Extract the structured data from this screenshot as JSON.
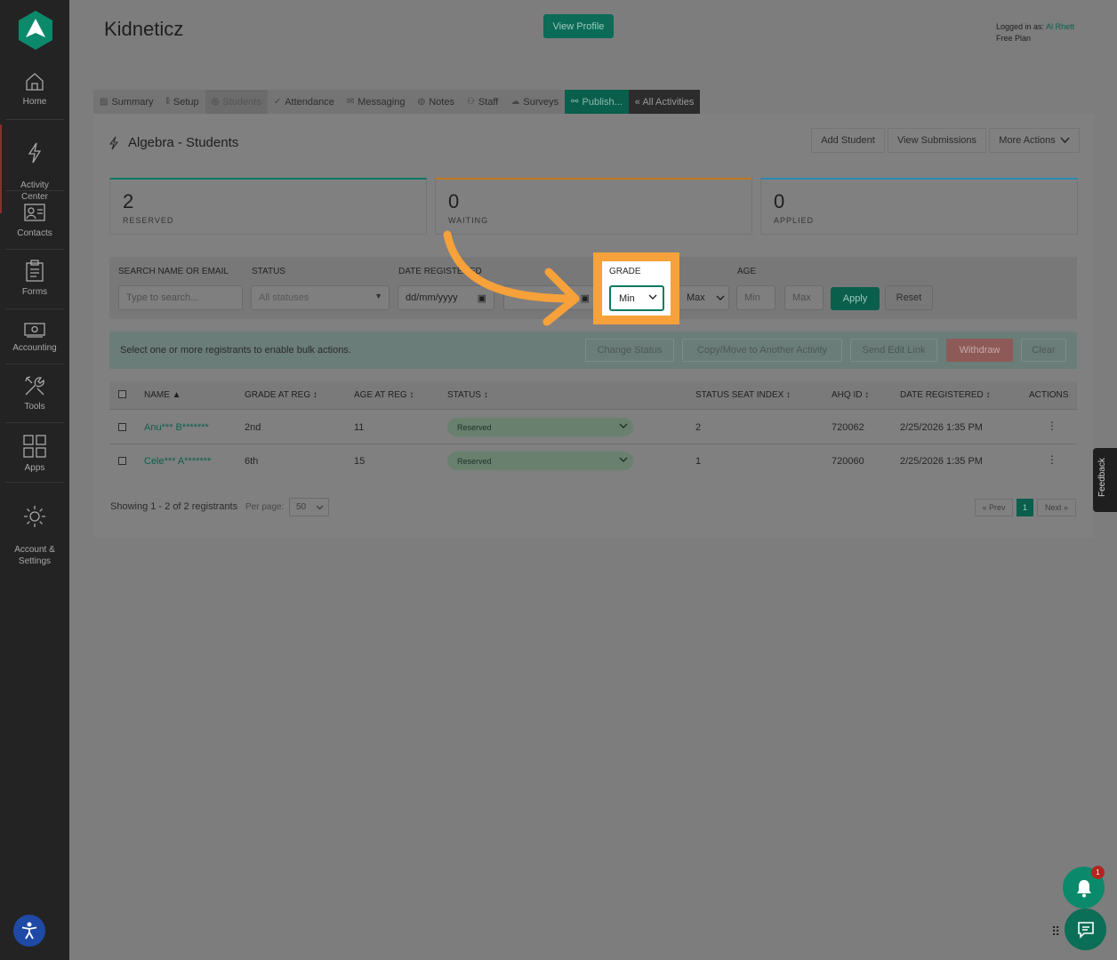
{
  "sidebar": {
    "items": [
      {
        "label": "Home",
        "icon": "home-icon"
      },
      {
        "label": "Activity\nCenter",
        "icon": "lightning-icon"
      },
      {
        "label": "Contacts",
        "icon": "contacts-icon"
      },
      {
        "label": "Forms",
        "icon": "clipboard-icon"
      },
      {
        "label": "Accounting",
        "icon": "money-icon"
      },
      {
        "label": "Tools",
        "icon": "tools-icon"
      },
      {
        "label": "Apps",
        "icon": "apps-grid-icon"
      },
      {
        "label": "Account &\nSettings",
        "icon": "gear-icon"
      }
    ]
  },
  "header": {
    "title": "Kidneticz",
    "view_profile": "View Profile",
    "logged_in_label": "Logged in as: ",
    "user": "Al Rhett",
    "plan": "Free Plan"
  },
  "tabs": [
    {
      "label": "Summary",
      "icon": "summary-icon"
    },
    {
      "label": "Setup",
      "icon": "setup-icon"
    },
    {
      "label": "Students",
      "icon": "students-icon"
    },
    {
      "label": "Attendance",
      "icon": "check-icon"
    },
    {
      "label": "Messaging",
      "icon": "mail-icon"
    },
    {
      "label": "Notes",
      "icon": "notes-icon"
    },
    {
      "label": "Staff",
      "icon": "staff-icon"
    },
    {
      "label": "Surveys",
      "icon": "cloud-icon"
    },
    {
      "label": "Publish...",
      "icon": "link-icon"
    },
    {
      "label": "« All Activities",
      "icon": ""
    }
  ],
  "section": {
    "title": "Algebra - Students",
    "add_student": "Add Student",
    "view_submissions": "View Submissions",
    "more_actions": "More Actions"
  },
  "stats": [
    {
      "value": "2",
      "label": "RESERVED",
      "color": "#0b7a63"
    },
    {
      "value": "0",
      "label": "WAITING",
      "color": "#c07a1e"
    },
    {
      "value": "0",
      "label": "APPLIED",
      "color": "#2a8ab3"
    }
  ],
  "filters": {
    "search_label": "SEARCH NAME OR EMAIL",
    "search_placeholder": "Type to search...",
    "status_label": "STATUS",
    "status_value": "All statuses",
    "date_label": "DATE REGISTERED",
    "date_from": "dd/mm/yyyy",
    "grade_label": "GRADE",
    "grade_min": "Min",
    "grade_max": "Max",
    "age_label": "AGE",
    "age_min": "Min",
    "age_max": "Max",
    "apply": "Apply",
    "reset": "Reset"
  },
  "bulk": {
    "text": "Select one or more registrants to enable bulk actions.",
    "change_status": "Change Status",
    "copy_move": "Copy/Move to Another Activity",
    "send_edit_link": "Send Edit Link",
    "withdraw": "Withdraw",
    "clear": "Clear"
  },
  "table": {
    "headers": [
      "NAME ▲",
      "GRADE AT REG ↕",
      "AGE AT REG ↕",
      "STATUS ↕",
      "STATUS SEAT INDEX ↕",
      "AHQ ID ↕",
      "DATE REGISTERED ↕",
      "ACTIONS"
    ],
    "rows": [
      {
        "name": "Anu*** B*******",
        "grade": "2nd",
        "age": "11",
        "status": "Reserved",
        "seat": "2",
        "ahq": "720062",
        "date": "2/25/2026 1:35 PM"
      },
      {
        "name": "Cele*** A*******",
        "grade": "6th",
        "age": "15",
        "status": "Reserved",
        "seat": "1",
        "ahq": "720060",
        "date": "2/25/2026 1:35 PM"
      }
    ]
  },
  "footer": {
    "showing": "Showing 1 - 2 of 2 registrants",
    "per_page_label": "Per page:",
    "per_page_value": "50",
    "prev": "« Prev",
    "current": "1",
    "next": "Next »"
  },
  "widgets": {
    "feedback": "Feedback",
    "badge": "1"
  },
  "colors": {
    "accent": "#0b6b57",
    "highlight": "#f7a13a"
  }
}
